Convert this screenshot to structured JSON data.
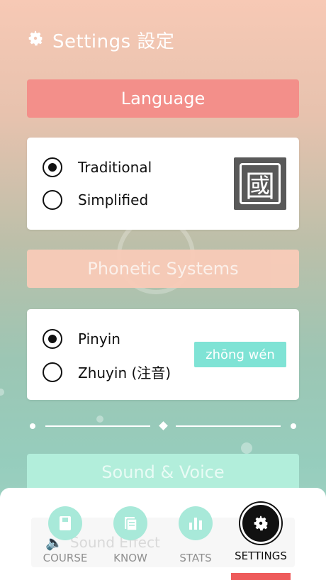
{
  "header": {
    "title": "Settings 設定",
    "icon": "gear-icon"
  },
  "sections": {
    "language": {
      "label": "Language",
      "options": [
        {
          "label": "Traditional",
          "selected": true
        },
        {
          "label": "Simplified",
          "selected": false
        }
      ],
      "preview_char": "國"
    },
    "phonetic": {
      "label": "Phonetic Systems",
      "options": [
        {
          "label": "Pinyin",
          "selected": true
        },
        {
          "label": "Zhuyin (注音)",
          "selected": false
        }
      ],
      "preview_text": "zhōng wén"
    },
    "sound": {
      "label": "Sound & Voice",
      "first_item": "Sound Effect"
    }
  },
  "tabs": [
    {
      "label": "COURSE",
      "icon": "book-icon",
      "active": false
    },
    {
      "label": "KNOW",
      "icon": "cards-icon",
      "active": false
    },
    {
      "label": "STATS",
      "icon": "bar-chart-icon",
      "active": false
    },
    {
      "label": "SETTINGS",
      "icon": "gear-icon",
      "active": true
    }
  ],
  "colors": {
    "language_bar": "#f38f8a",
    "phonetic_bar": "#f9cbb8",
    "sound_bar": "#b2eedb",
    "tab_circle": "#a8e9d9",
    "active_indicator": "#ee5b5b"
  }
}
